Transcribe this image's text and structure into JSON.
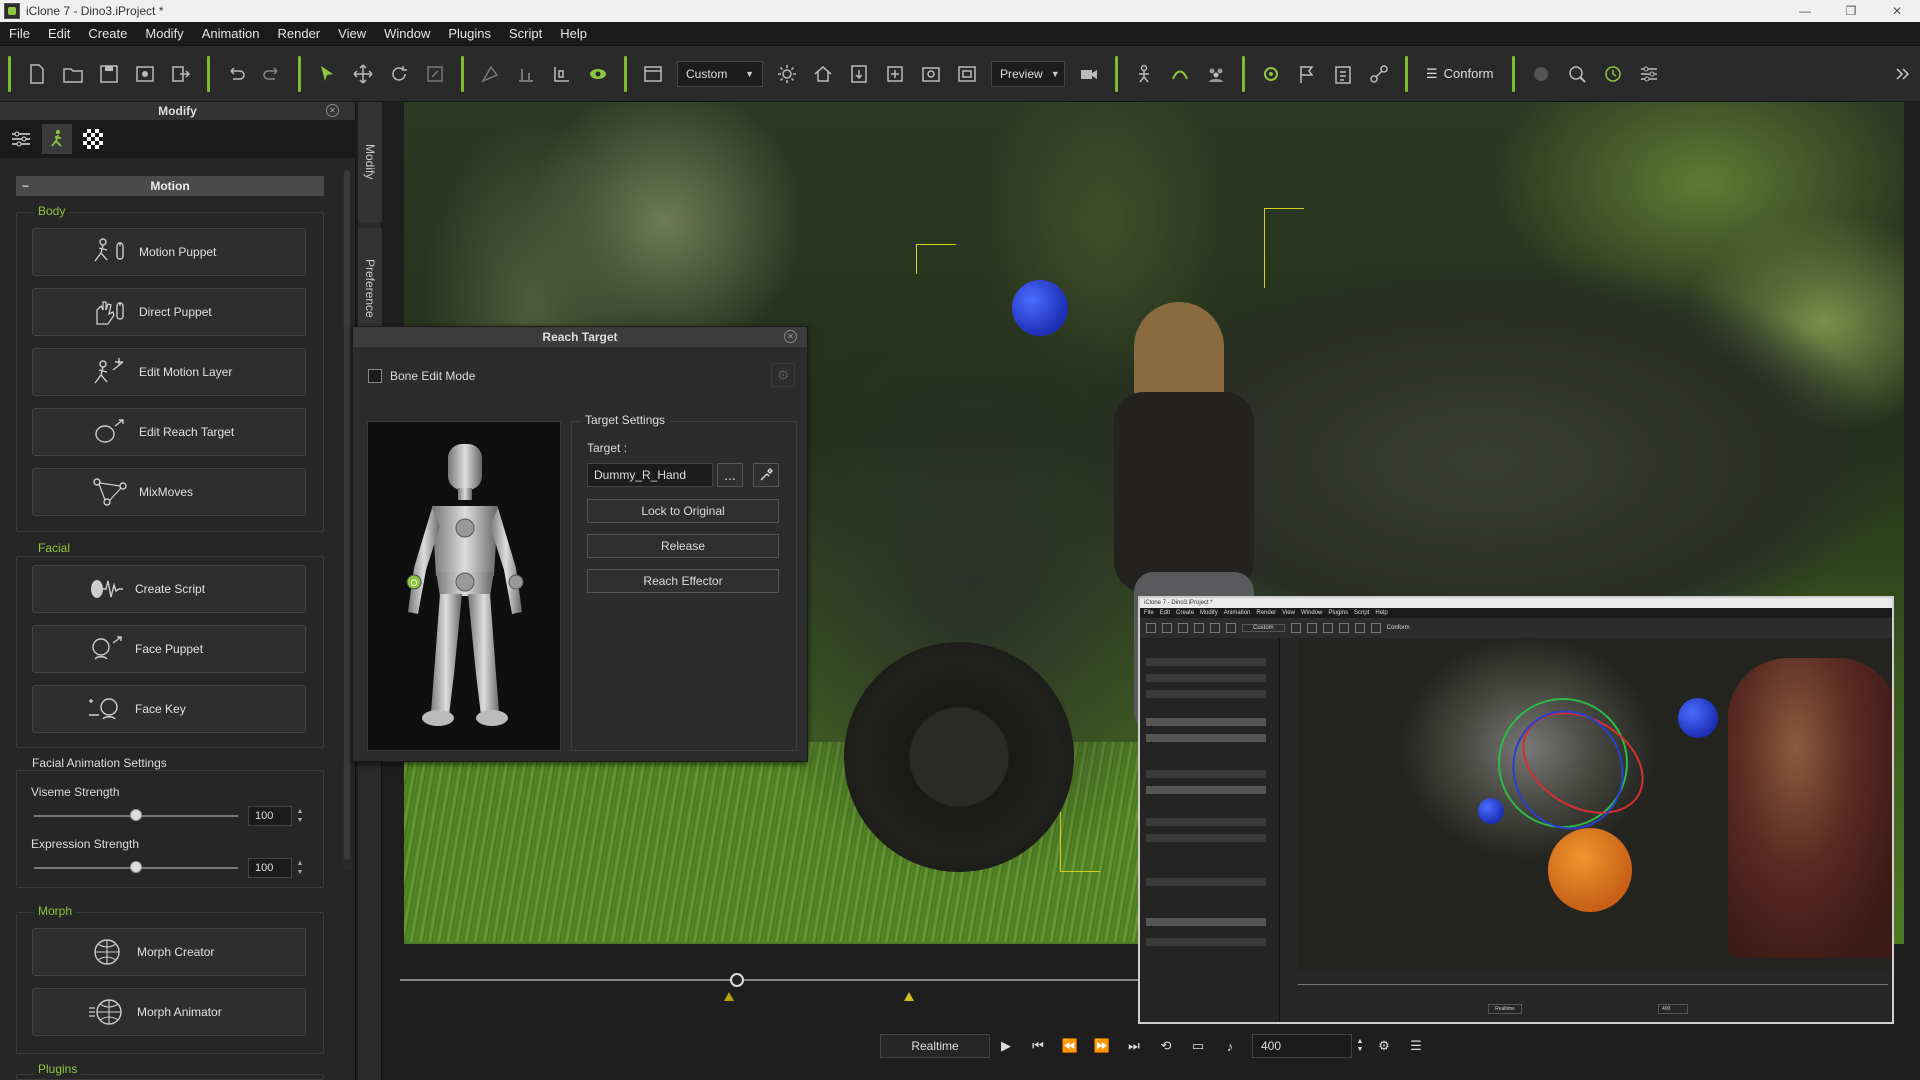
{
  "window": {
    "title": "iClone 7 - Dino3.iProject *",
    "controls": [
      "—",
      "❐",
      "✕"
    ]
  },
  "menubar": [
    "File",
    "Edit",
    "Create",
    "Modify",
    "Animation",
    "Render",
    "View",
    "Window",
    "Plugins",
    "Script",
    "Help"
  ],
  "toolbar": {
    "camera_dropdown": "Custom",
    "quality_dropdown": "Preview",
    "conform_label": "Conform",
    "accent_color": "#7dbb2f"
  },
  "modify_panel": {
    "title": "Modify",
    "side_tabs": [
      "Modify",
      "Preference"
    ],
    "motion_header": "Motion",
    "body_group": {
      "title": "Body",
      "buttons": [
        {
          "label": "Motion Puppet",
          "icon": "motion-puppet-icon"
        },
        {
          "label": "Direct Puppet",
          "icon": "direct-puppet-icon"
        },
        {
          "label": "Edit Motion Layer",
          "icon": "edit-motion-layer-icon"
        },
        {
          "label": "Edit Reach Target",
          "icon": "edit-reach-target-icon"
        },
        {
          "label": "MixMoves",
          "icon": "mixmoves-icon"
        }
      ]
    },
    "facial_group": {
      "title": "Facial",
      "buttons": [
        {
          "label": "Create Script",
          "icon": "create-script-icon"
        },
        {
          "label": "Face Puppet",
          "icon": "face-puppet-icon"
        },
        {
          "label": "Face Key",
          "icon": "face-key-icon"
        }
      ]
    },
    "facial_settings": {
      "title": "Facial Animation Settings",
      "viseme_label": "Viseme Strength",
      "viseme_value": "100",
      "viseme_level": 0.5,
      "expression_label": "Expression Strength",
      "expression_value": "100",
      "expression_level": 0.5
    },
    "morph_group": {
      "title": "Morph",
      "buttons": [
        {
          "label": "Morph Creator",
          "icon": "morph-creator-icon"
        },
        {
          "label": "Morph Animator",
          "icon": "morph-animator-icon"
        }
      ]
    },
    "plugins_title": "Plugins"
  },
  "reach_target": {
    "title": "Reach Target",
    "bone_edit_mode": "Bone Edit Mode",
    "target_settings": "Target Settings",
    "target_label": "Target :",
    "target_value": "Dummy_R_Hand",
    "more_button": "...",
    "lock_button": "Lock to Original",
    "release_button": "Release",
    "reach_effector_button": "Reach Effector"
  },
  "playback": {
    "realtime": "Realtime",
    "frame": "400"
  },
  "inset": {
    "title": "iClone 7 - Dino3.iProject *",
    "menu": [
      "File",
      "Edit",
      "Create",
      "Modify",
      "Animation",
      "Render",
      "View",
      "Window",
      "Plugins",
      "Script",
      "Help"
    ],
    "camera_dropdown": "Custom",
    "conform": "Conform",
    "realtime": "Realtime",
    "frame": "400"
  }
}
